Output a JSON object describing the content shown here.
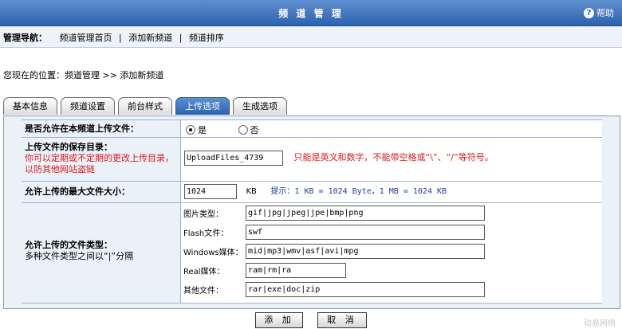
{
  "header": {
    "title": "频 道 管 理",
    "help_label": "帮助",
    "help_icon": "question-circle-icon"
  },
  "nav": {
    "label": "管理导航：",
    "links": [
      "频道管理首页",
      "添加新频道",
      "频道排序"
    ],
    "separator": "|"
  },
  "breadcrumb": "您现在的位置：频道管理 >> 添加新频道",
  "tabs": [
    {
      "label": "基本信息",
      "active": false
    },
    {
      "label": "频道设置",
      "active": false
    },
    {
      "label": "前台样式",
      "active": false
    },
    {
      "label": "上传选项",
      "active": true
    },
    {
      "label": "生成选项",
      "active": false
    }
  ],
  "form": {
    "allow_upload": {
      "label": "是否允许在本频道上传文件：",
      "yes": "是",
      "no": "否",
      "selected": "yes"
    },
    "save_dir": {
      "label": "上传文件的保存目录：",
      "note": "你可以定期或不定期的更改上传目录，以防其他网站盗链",
      "value": "UploadFiles_4739",
      "hint": "只能是英文和数字，不能带空格或“\\”、“/”等符号。"
    },
    "max_size": {
      "label": "允许上传的最大文件大小：",
      "value": "1024",
      "unit": "KB",
      "hint": "提示：1 KB = 1024 Byte，1 MB = 1024 KB"
    },
    "file_types": {
      "label": "允许上传的文件类型：",
      "note": "多种文件类型之间以“|”分隔",
      "items": [
        {
          "label": "图片类型：",
          "value": "gif|jpg|jpeg|jpe|bmp|png"
        },
        {
          "label": "Flash文件：",
          "value": "swf"
        },
        {
          "label": "Windows媒体：",
          "value": "mid|mp3|wmv|asf|avi|mpg"
        },
        {
          "label": "Real媒体：",
          "value": "ram|rm|ra"
        },
        {
          "label": "其他文件：",
          "value": "rar|exe|doc|zip"
        }
      ]
    }
  },
  "buttons": {
    "add": "添 加",
    "cancel": "取 消"
  },
  "watermark": "动易网络"
}
